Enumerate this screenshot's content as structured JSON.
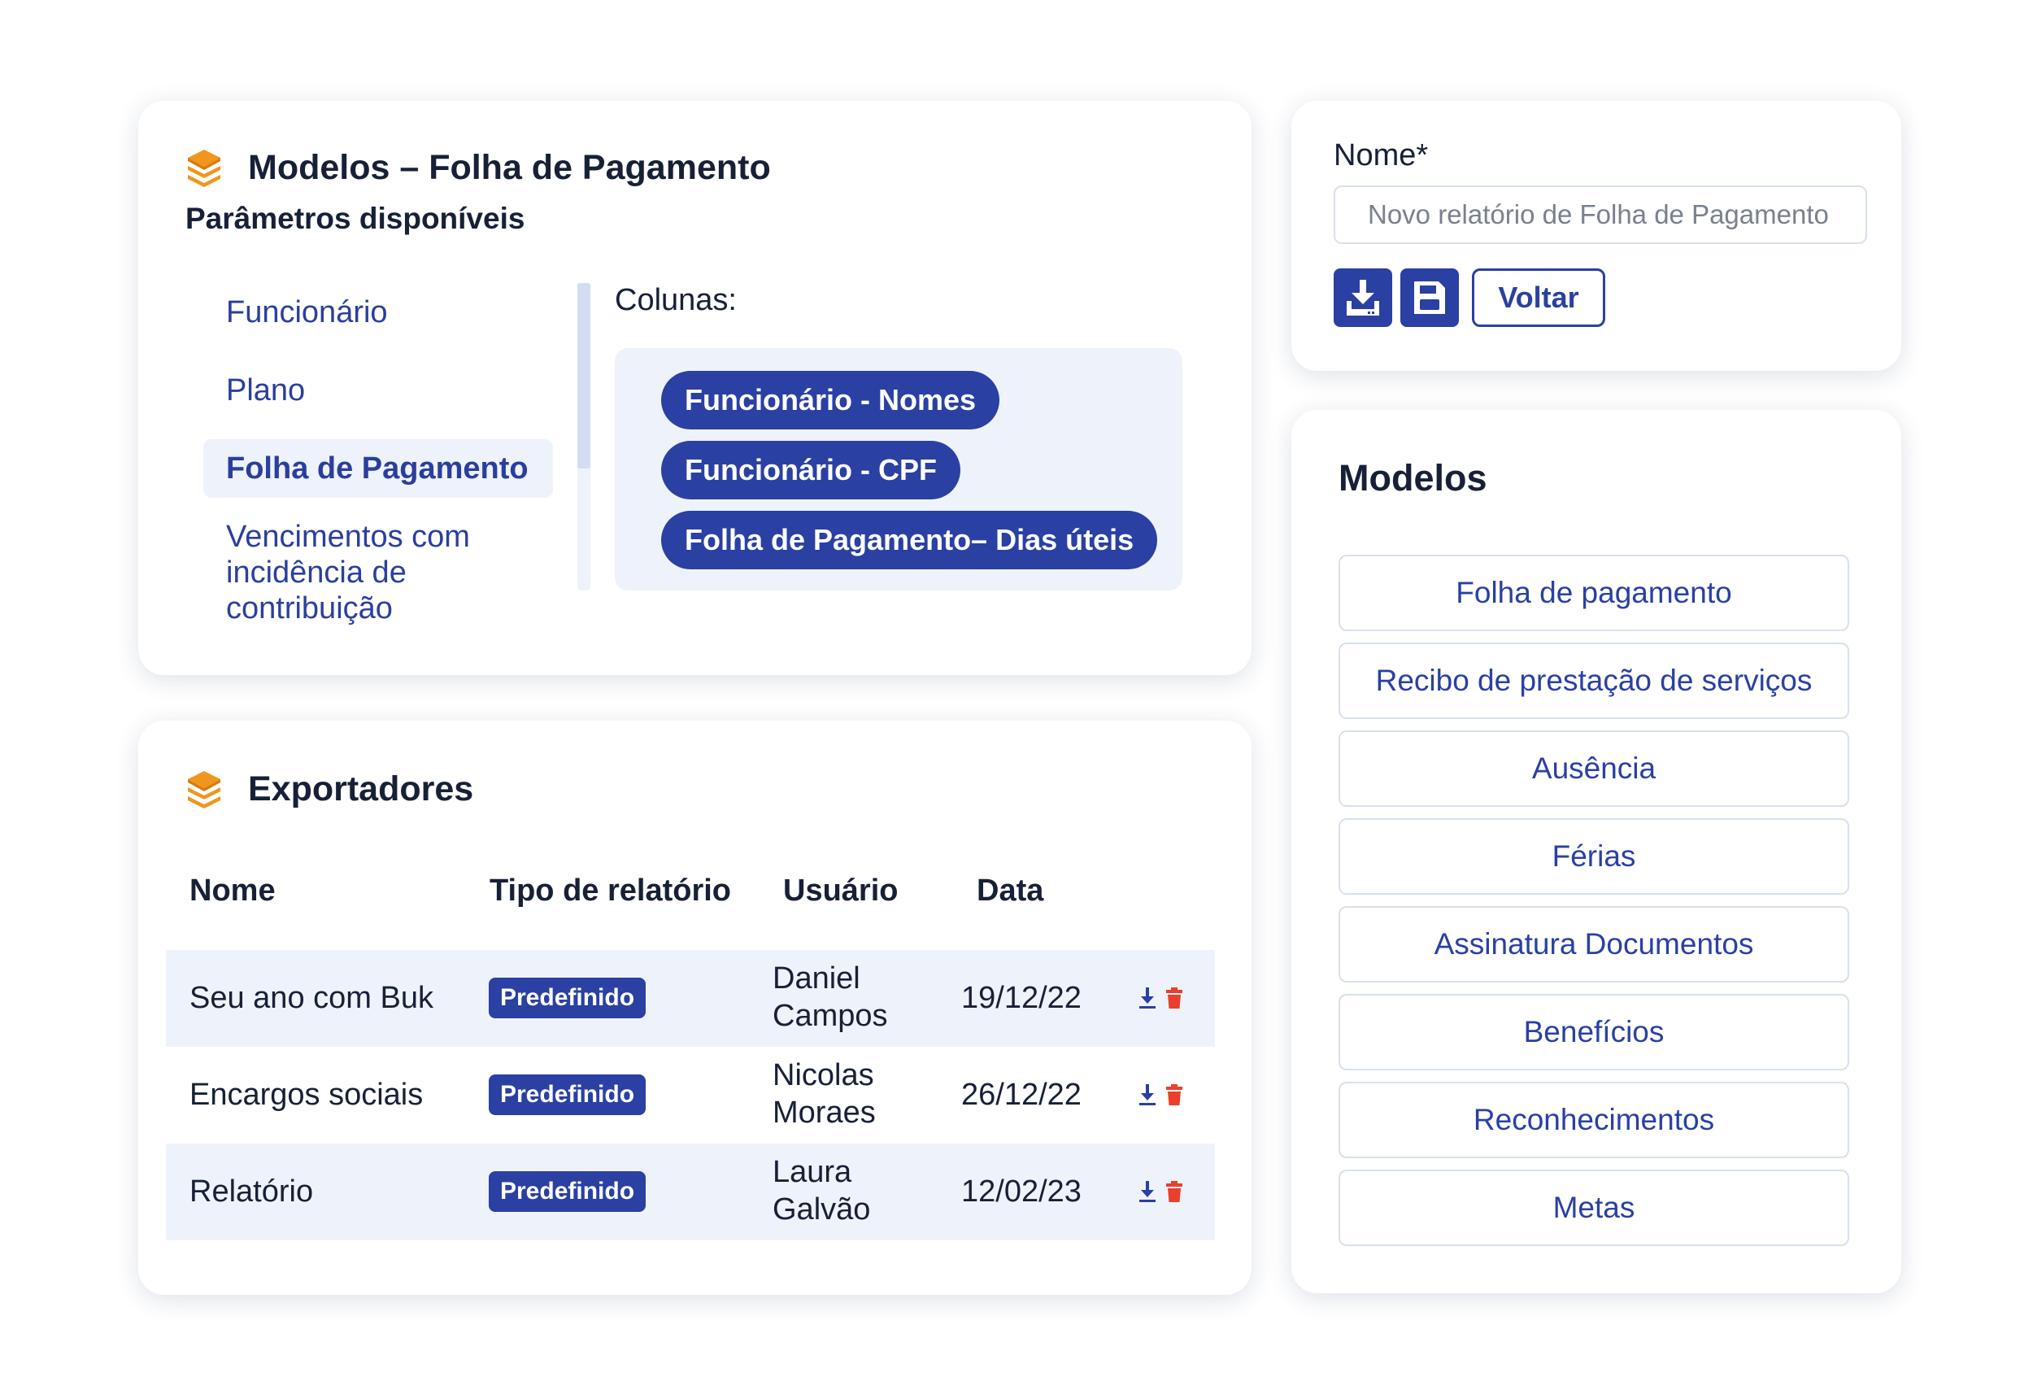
{
  "colors": {
    "primary": "#2a40a3",
    "accent_orange": "#f0961e",
    "danger_red": "#e8402a",
    "title_text": "#172036",
    "light_bg": "#eef2fb",
    "border": "#d8e0ef"
  },
  "models_card": {
    "icon": "layers-icon",
    "title": "Modelos – Folha de Pagamento",
    "subtitle": "Parâmetros disponíveis",
    "params": [
      {
        "label": "Funcionário"
      },
      {
        "label": "Plano"
      },
      {
        "label": "Folha de Pagamento",
        "selected": true
      },
      {
        "label": "Vencimentos com incidência de contribuição"
      }
    ],
    "columns_label": "Colunas:",
    "columns": [
      "Funcionário - Nomes",
      "Funcionário - CPF",
      "Folha de Pagamento– Dias úteis"
    ]
  },
  "exporters_card": {
    "icon": "layers-icon",
    "title": "Exportadores",
    "headers": [
      "Nome",
      "Tipo de relatório",
      "Usuário",
      "Data"
    ],
    "rows": [
      {
        "name": "Seu ano com Buk",
        "type": "Predefinido",
        "user": "Daniel Campos",
        "date": "19/12/22"
      },
      {
        "name": "Encargos sociais",
        "type": "Predefinido",
        "user": "Nicolas Moraes",
        "date": "26/12/22"
      },
      {
        "name": "Relatório",
        "type": "Predefinido",
        "user": "Laura Galvão",
        "date": "12/02/23"
      }
    ],
    "row_actions": [
      "download-icon",
      "trash-icon"
    ]
  },
  "name_card": {
    "label": "Nome*",
    "placeholder": "Novo relatório de Folha de Pagamento",
    "value": "",
    "download_icon": "download-tray-icon",
    "save_icon": "floppy-disk-icon",
    "back_label": "Voltar"
  },
  "modelos_list": {
    "title": "Modelos",
    "items": [
      "Folha de pagamento",
      "Recibo de prestação de serviços",
      "Ausência",
      "Férias",
      "Assinatura Documentos",
      "Benefícios",
      "Reconhecimentos",
      "Metas"
    ]
  }
}
